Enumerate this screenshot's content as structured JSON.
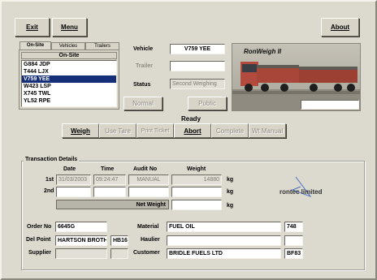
{
  "toolbar": {
    "exit_label": "Exit",
    "menu_label": "Menu",
    "about_label": "About"
  },
  "tabs": [
    {
      "label": "On-Site"
    },
    {
      "label": "Vehicles"
    },
    {
      "label": "Trailers"
    }
  ],
  "onsite_list": {
    "header": "On-Site",
    "items": [
      "G884 JDP",
      "T444 LJX",
      "V759 YEE",
      "W423 LSP",
      "X745 TWL",
      "YL52 RPE"
    ],
    "selected_index": 2
  },
  "vehicle_form": {
    "vehicle_label": "Vehicle",
    "vehicle_value": "V759 YEE",
    "trailer_label": "Trailer",
    "trailer_value": "",
    "status_label": "Status",
    "status_value": "Second Weighing",
    "normal_label": "Normal",
    "public_label": "Public"
  },
  "banner": {
    "title": "RonWeigh II"
  },
  "status_text": "Ready",
  "actions": [
    {
      "label": "Weigh",
      "enabled": true
    },
    {
      "label": "Use Tare",
      "enabled": false
    },
    {
      "label": "Print Ticket",
      "enabled": false
    },
    {
      "label": "Abort",
      "enabled": true
    },
    {
      "label": "Complete",
      "enabled": false
    },
    {
      "label": "Wt Manual",
      "enabled": false
    }
  ],
  "transaction": {
    "group_title": "Transaction Details",
    "col_date": "Date",
    "col_time": "Time",
    "col_audit": "Audit No",
    "col_weight": "Weight",
    "row1_label": "1st",
    "row1_date": "31/03/2003",
    "row1_time": "09:24:47",
    "row1_audit": "MANUAL",
    "row1_weight": "14880",
    "row1_unit": "kg",
    "row2_label": "2nd",
    "row2_date": "",
    "row2_time": "",
    "row2_audit": "",
    "row2_weight": "",
    "row2_unit": "kg",
    "net_label": "Net Weight",
    "net_value": "",
    "net_unit": "kg"
  },
  "logo_text": "rontec limited",
  "order": {
    "order_no_label": "Order No",
    "order_no_value": "6645G",
    "del_point_label": "Del Point",
    "del_point_value": "HARTSON BROTHERS",
    "del_point_code": "HB16",
    "supplier_label": "Supplier",
    "supplier_value": "",
    "supplier_code": "",
    "material_label": "Material",
    "material_value": "FUEL OIL",
    "material_code": "748",
    "haulier_label": "Haulier",
    "haulier_value": "",
    "haulier_code": "",
    "customer_label": "Customer",
    "customer_value": "BRIDLE FUELS LTD",
    "customer_code": "BF83"
  }
}
